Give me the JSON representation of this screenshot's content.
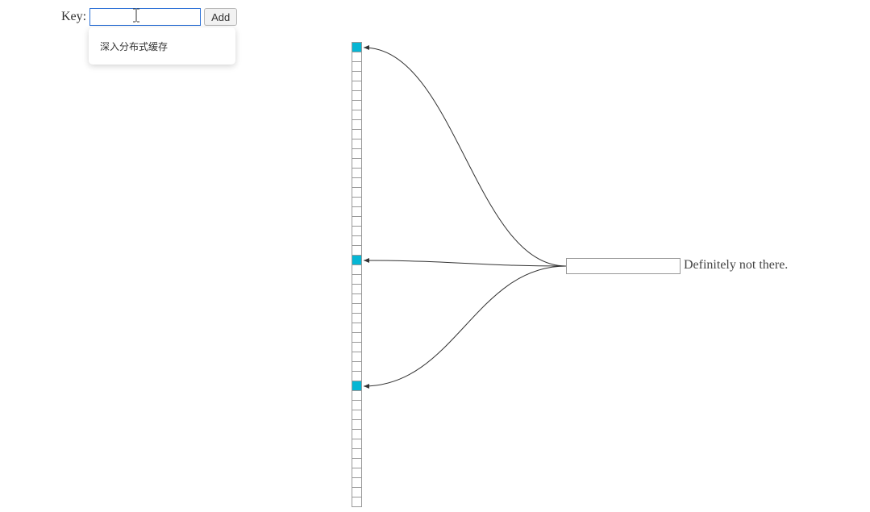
{
  "form": {
    "key_label": "Key:",
    "key_value": "",
    "add_label": "Add"
  },
  "autocomplete": {
    "suggestion": "深入分布式缓存"
  },
  "diagram": {
    "bit_count": 48,
    "set_bits": [
      0,
      22,
      35
    ],
    "query_value": "",
    "result_text": "Definitely not there.",
    "arrows": [
      {
        "target_bit": 0
      },
      {
        "target_bit": 22
      },
      {
        "target_bit": 35
      }
    ],
    "colors": {
      "set_bit": "#06b6d4",
      "curve": "#333333"
    }
  }
}
